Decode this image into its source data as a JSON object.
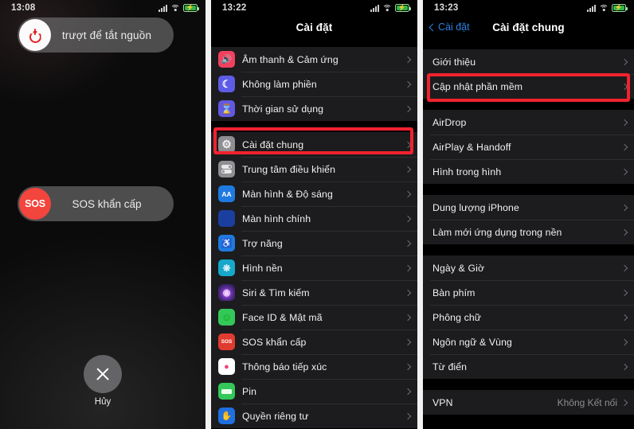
{
  "panel1": {
    "statusbar": {
      "time": "13:08",
      "signal_icon": "cellular-bars-icon",
      "wifi_icon": "wifi-icon",
      "battery_icon": "battery-charging-icon"
    },
    "power_slider": {
      "label": "trượt để tắt nguồn",
      "icon": "power-icon"
    },
    "sos_slider": {
      "knob_label": "SOS",
      "label": "SOS khẩn cấp",
      "icon": "sos-icon"
    },
    "cancel": {
      "label": "Hủy",
      "icon": "close-icon"
    }
  },
  "panel2": {
    "statusbar": {
      "time": "13:22"
    },
    "nav": {
      "title": "Cài đặt"
    },
    "rows": [
      {
        "label": "Âm thanh & Cảm ứng",
        "icon": "speaker-icon",
        "color": "#f1415f"
      },
      {
        "label": "Không làm phiền",
        "icon": "moon-icon",
        "color": "#5e5ce6"
      },
      {
        "label": "Thời gian sử dụng",
        "icon": "hourglass-icon",
        "color": "#6159e0"
      },
      {
        "label": "Cài đặt chung",
        "icon": "gear-icon",
        "color": "#8e8e93",
        "highlighted": true
      },
      {
        "label": "Trung tâm điều khiển",
        "icon": "control-center-icon",
        "color": "#8e8e93"
      },
      {
        "label": "Màn hình & Độ sáng",
        "icon": "display-brightness-icon",
        "color": "#1f7ae0"
      },
      {
        "label": "Màn hình chính",
        "icon": "home-screen-icon",
        "color": "#1b3fa0"
      },
      {
        "label": "Trợ năng",
        "icon": "accessibility-icon",
        "color": "#1f7ae0"
      },
      {
        "label": "Hình nền",
        "icon": "wallpaper-icon",
        "color": "#17a7c9"
      },
      {
        "label": "Siri & Tìm kiếm",
        "icon": "siri-icon",
        "color": "#2b2b4a"
      },
      {
        "label": "Face ID & Mật mã",
        "icon": "face-id-icon",
        "color": "#34c759"
      },
      {
        "label": "SOS khẩn cấp",
        "icon": "sos-icon",
        "color": "#e03b30"
      },
      {
        "label": "Thông báo tiếp xúc",
        "icon": "exposure-notification-icon",
        "color": "#ffffff"
      },
      {
        "label": "Pin",
        "icon": "battery-icon",
        "color": "#34c759"
      },
      {
        "label": "Quyền riêng tư",
        "icon": "privacy-hand-icon",
        "color": "#1f6fe0"
      }
    ]
  },
  "panel3": {
    "statusbar": {
      "time": "13:23"
    },
    "nav": {
      "back_label": "Cài đặt",
      "title": "Cài đặt chung",
      "back_icon": "chevron-left-icon",
      "accent": "#2f7fe0"
    },
    "group1": [
      {
        "label": "Giới thiệu"
      },
      {
        "label": "Cập nhật phần mềm",
        "highlighted": true
      }
    ],
    "group2": [
      {
        "label": "AirDrop"
      },
      {
        "label": "AirPlay & Handoff"
      },
      {
        "label": "Hình trong hình"
      }
    ],
    "group3": [
      {
        "label": "Dung lượng iPhone"
      },
      {
        "label": "Làm mới ứng dụng trong nền"
      }
    ],
    "group4": [
      {
        "label": "Ngày & Giờ"
      },
      {
        "label": "Bàn phím"
      },
      {
        "label": "Phông chữ"
      },
      {
        "label": "Ngôn ngữ & Vùng"
      },
      {
        "label": "Từ điển"
      }
    ],
    "group5": [
      {
        "label": "VPN",
        "value": "Không Kết nối"
      }
    ]
  },
  "highlight_color": "#f1222e"
}
